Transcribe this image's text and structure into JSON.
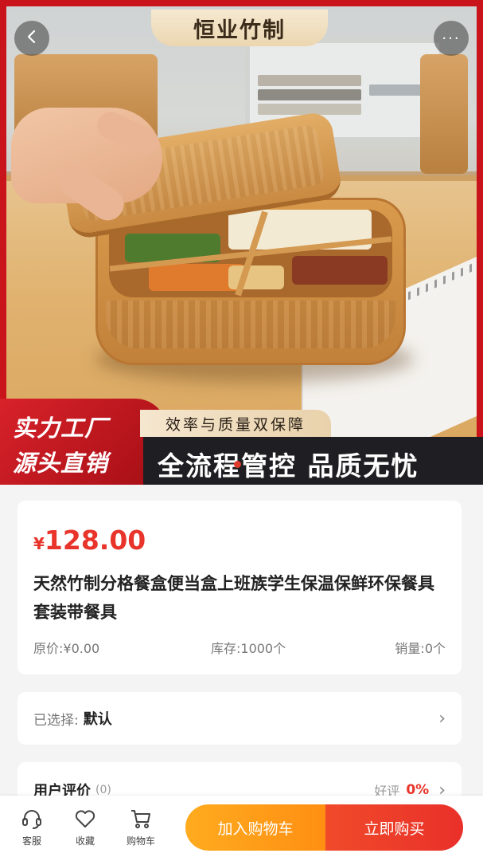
{
  "hero": {
    "brand_title": "恒业竹制",
    "promo_line1": "实力工厂",
    "promo_line2": "源头直销",
    "promo_caption": "效率与质量双保障",
    "promo_main": "全流程管控 品质无忧",
    "back_icon": "chevron-left-icon",
    "more_icon": "more-dots-icon",
    "more_label": "···"
  },
  "product": {
    "currency": "¥",
    "price": "128.00",
    "title": "天然竹制分格餐盒便当盒上班族学生保温保鲜环保餐具套装带餐具",
    "original_price": "原价:¥0.00",
    "stock": "库存:1000个",
    "sales": "销量:0个"
  },
  "selection": {
    "label": "已选择:",
    "value": "默认",
    "chevron": "›"
  },
  "reviews": {
    "title": "用户评价",
    "count": "(0)",
    "good_label": "好评",
    "good_rate": "0%",
    "chevron": "›"
  },
  "bottom_bar": {
    "service": "客服",
    "favorite": "收藏",
    "cart": "购物车",
    "add_to_cart": "加入购物车",
    "buy_now": "立即购买"
  },
  "colors": {
    "accent_red": "#e8342a",
    "cart_orange": "#ff9a14",
    "banner_red": "#c9141c"
  }
}
